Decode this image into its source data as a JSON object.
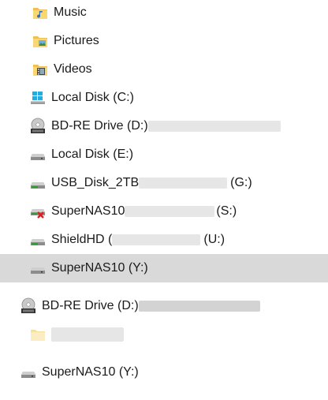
{
  "nav_items": [
    {
      "label": "Music",
      "icon": "music-folder-icon"
    },
    {
      "label": "Pictures",
      "icon": "pictures-folder-icon"
    },
    {
      "label": "Videos",
      "icon": "videos-folder-icon"
    },
    {
      "label": "Local Disk (C:)",
      "icon": "windows-drive-icon"
    },
    {
      "label_start": "BD-RE Drive (D:) ",
      "icon": "bluray-drive-icon"
    },
    {
      "label": "Local Disk (E:)",
      "icon": "hard-drive-icon"
    },
    {
      "label_start": "USB_Disk_2TB ",
      "label_end": "(G:)",
      "icon": "usb-drive-icon"
    },
    {
      "label_start": "SuperNAS10 ",
      "label_end": "(S:)",
      "icon": "disconnected-network-drive-icon"
    },
    {
      "label_start": "ShieldHD (",
      "label_end": "(U:)",
      "icon": "network-drive-icon"
    },
    {
      "label": "SuperNAS10 (Y:)",
      "icon": "network-drive-icon"
    }
  ],
  "drag_items": [
    {
      "label_start": "BD-RE Drive (D:) ",
      "icon": "bluray-drive-icon"
    },
    {
      "label": "",
      "icon": "folder-icon"
    },
    {
      "label": "SuperNAS10 (Y:)",
      "icon": "network-drive-icon"
    }
  ],
  "colors": {
    "folder_yellow": "#f6c65b",
    "selection_bg": "#d9d9d9",
    "windows_blue": "#2aa8e0",
    "drive_green": "#3a9a3a",
    "error_red": "#d42222"
  }
}
